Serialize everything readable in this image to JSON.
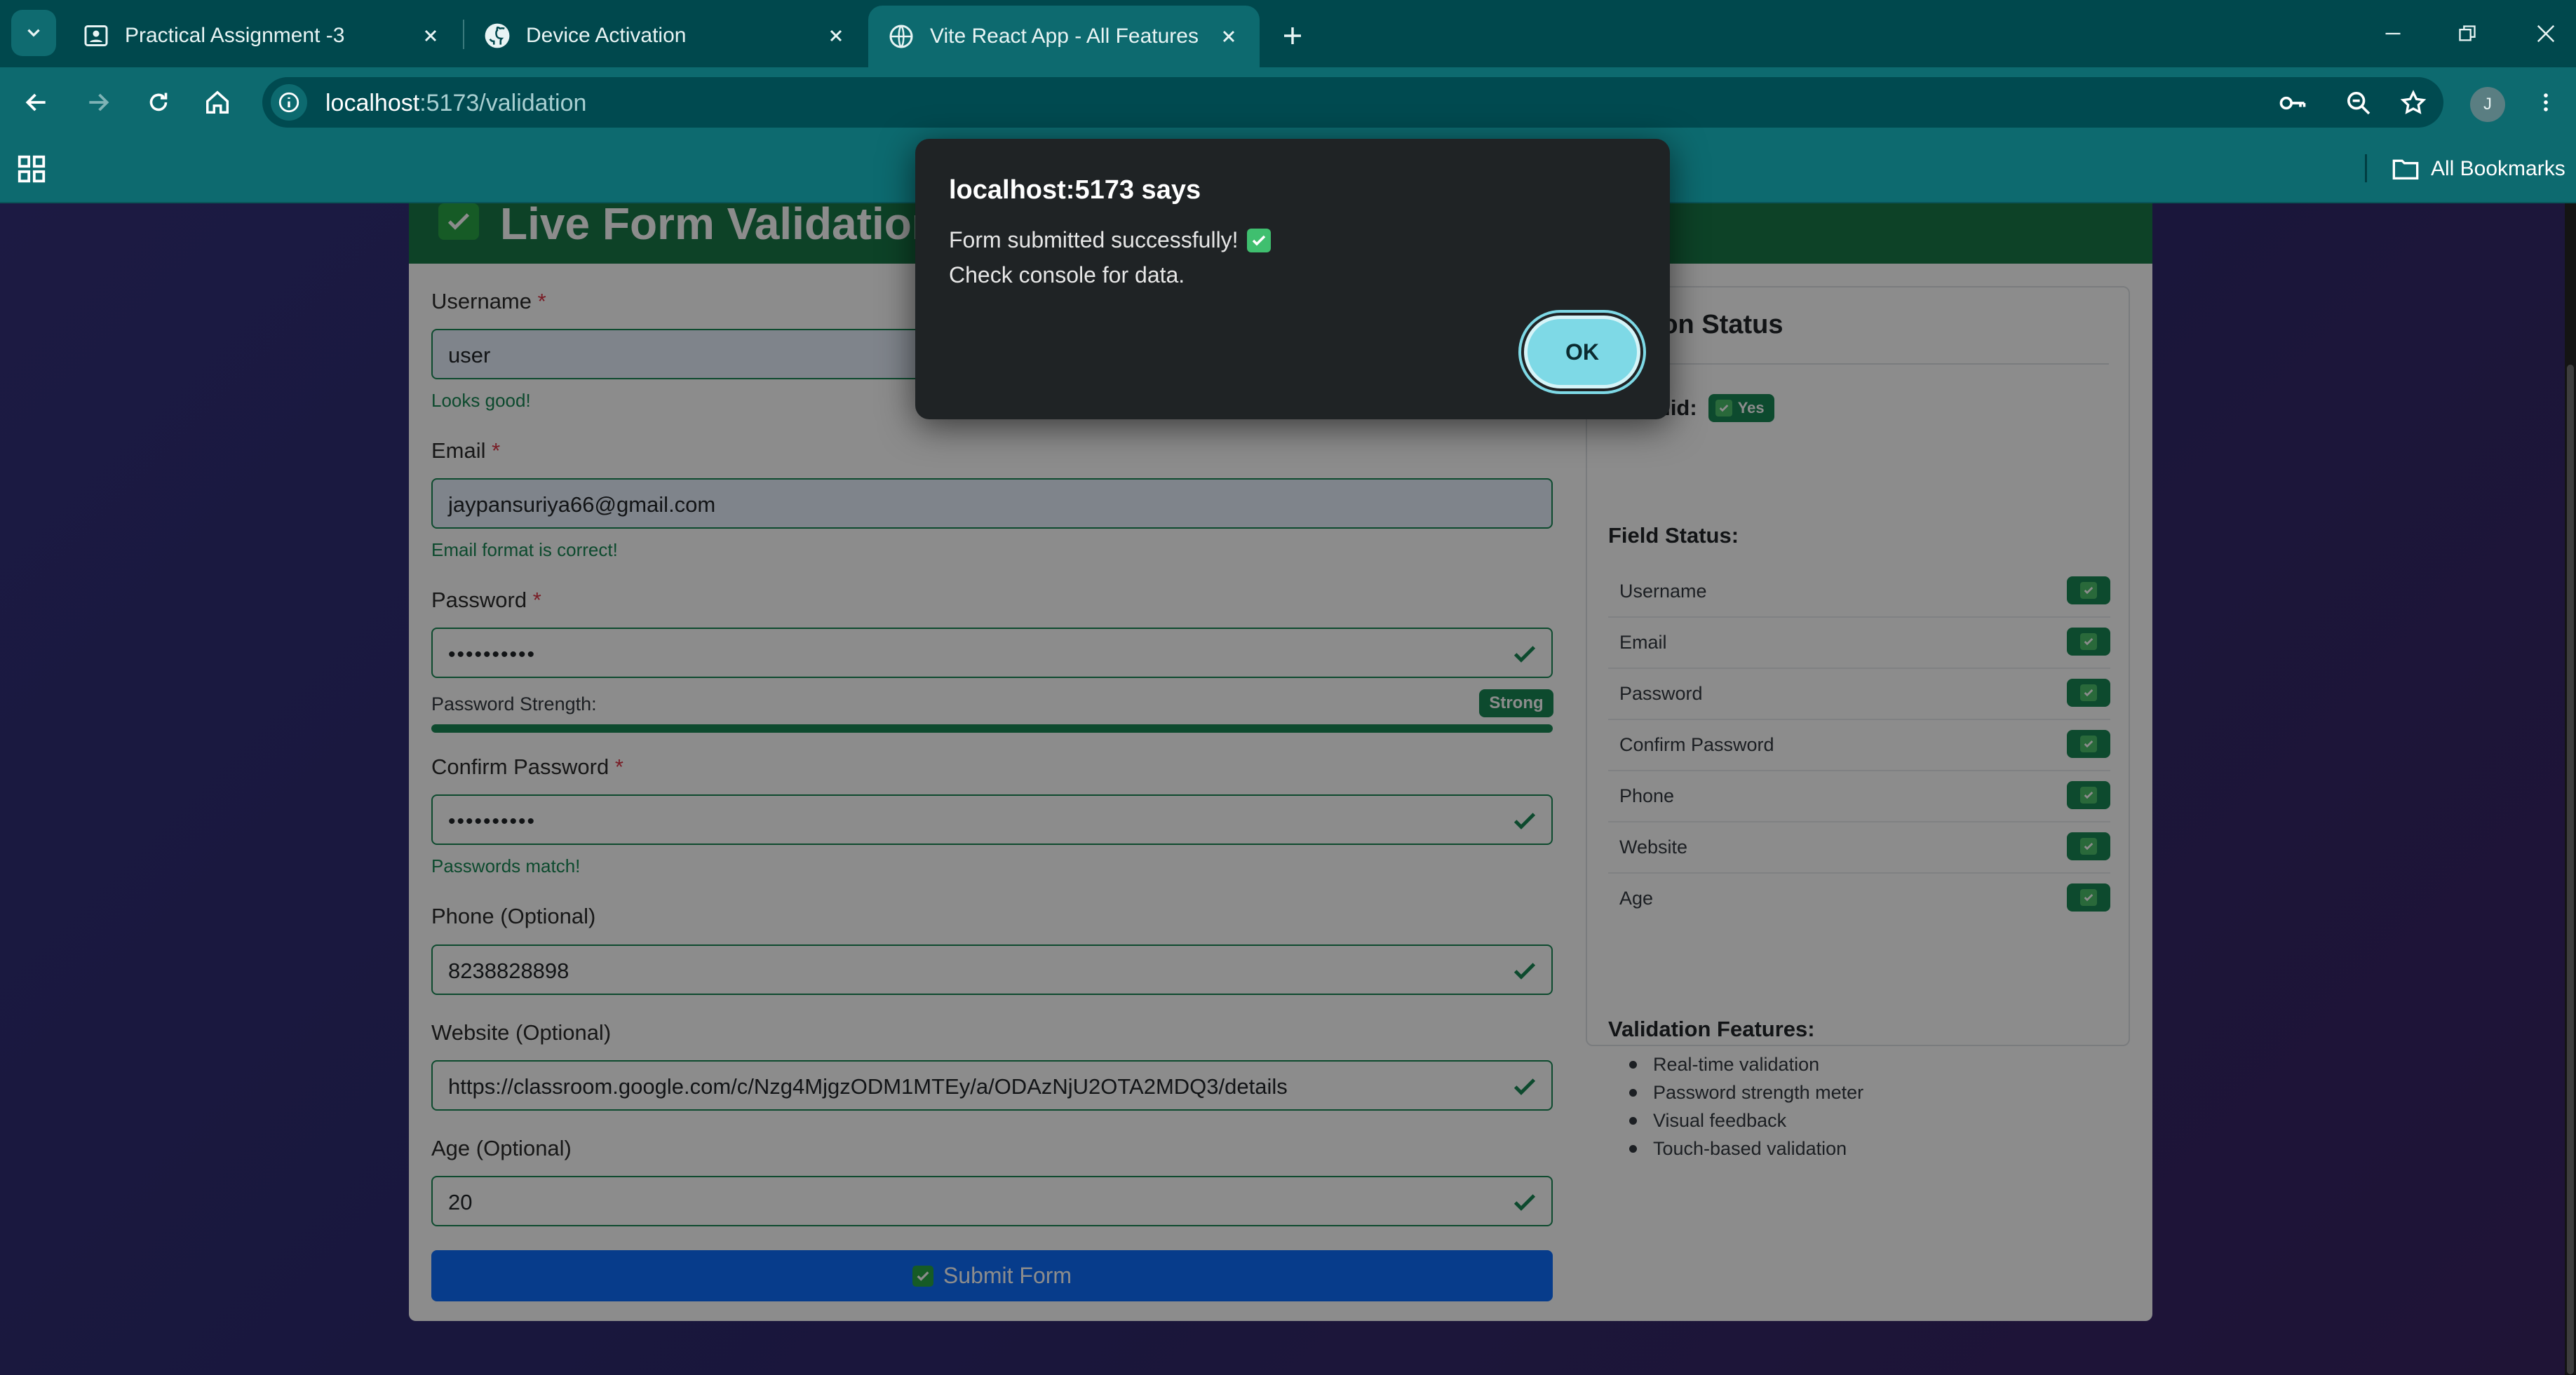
{
  "browser": {
    "tabs": [
      {
        "title": "Practical Assignment -3",
        "icon": "classroom-icon",
        "active": false
      },
      {
        "title": "Device Activation",
        "icon": "github-icon",
        "active": false
      },
      {
        "title": "Vite React App - All Features",
        "icon": "globe-icon",
        "active": true
      }
    ],
    "url_host": "localhost",
    "url_rest": ":5173/validation",
    "profile_initial": "J",
    "bookmarks_label": "All Bookmarks"
  },
  "page": {
    "heading": "Live Form Validation",
    "fields": {
      "username": {
        "label": "Username",
        "required": "*",
        "value": "user",
        "hint": "Looks good!"
      },
      "email": {
        "label": "Email",
        "required": "*",
        "value": "jaypansuriya66@gmail.com",
        "hint": "Email format is correct!"
      },
      "password": {
        "label": "Password",
        "required": "*",
        "value": "••••••••••"
      },
      "password_strength": {
        "label": "Password Strength:",
        "badge": "Strong",
        "level": 1.0
      },
      "confirm_password": {
        "label": "Confirm Password",
        "required": "*",
        "value": "••••••••••",
        "hint": "Passwords match!"
      },
      "phone": {
        "label": "Phone (Optional)",
        "value": "8238828898"
      },
      "website": {
        "label": "Website (Optional)",
        "value": "https://classroom.google.com/c/Nzg4MjgzODM1MTEy/a/ODAzNjU2OTA2MDQ3/details"
      },
      "age": {
        "label": "Age (Optional)",
        "value": "20"
      }
    },
    "submit_label": "Submit Form",
    "status_panel": {
      "title_visible": "ation Status",
      "form_valid_label": "Valid:",
      "form_valid_badge": "Yes",
      "field_status_title": "Field Status:",
      "field_status": [
        "Username",
        "Email",
        "Password",
        "Confirm Password",
        "Phone",
        "Website",
        "Age"
      ],
      "features_title": "Validation Features:",
      "features": [
        "Real-time validation",
        "Password strength meter",
        "Visual feedback",
        "Touch-based validation"
      ]
    }
  },
  "dialog": {
    "title": "localhost:5173 says",
    "message_line1": "Form submitted successfully!",
    "message_line2": "Check console for data.",
    "ok_label": "OK"
  },
  "colors": {
    "success": "#198754",
    "primary": "#0d6efd",
    "header_green": "#197847",
    "chrome_teal": "#0d6a6f",
    "dialog_bg": "#1f2325",
    "ok_button": "#7ed9e6"
  }
}
